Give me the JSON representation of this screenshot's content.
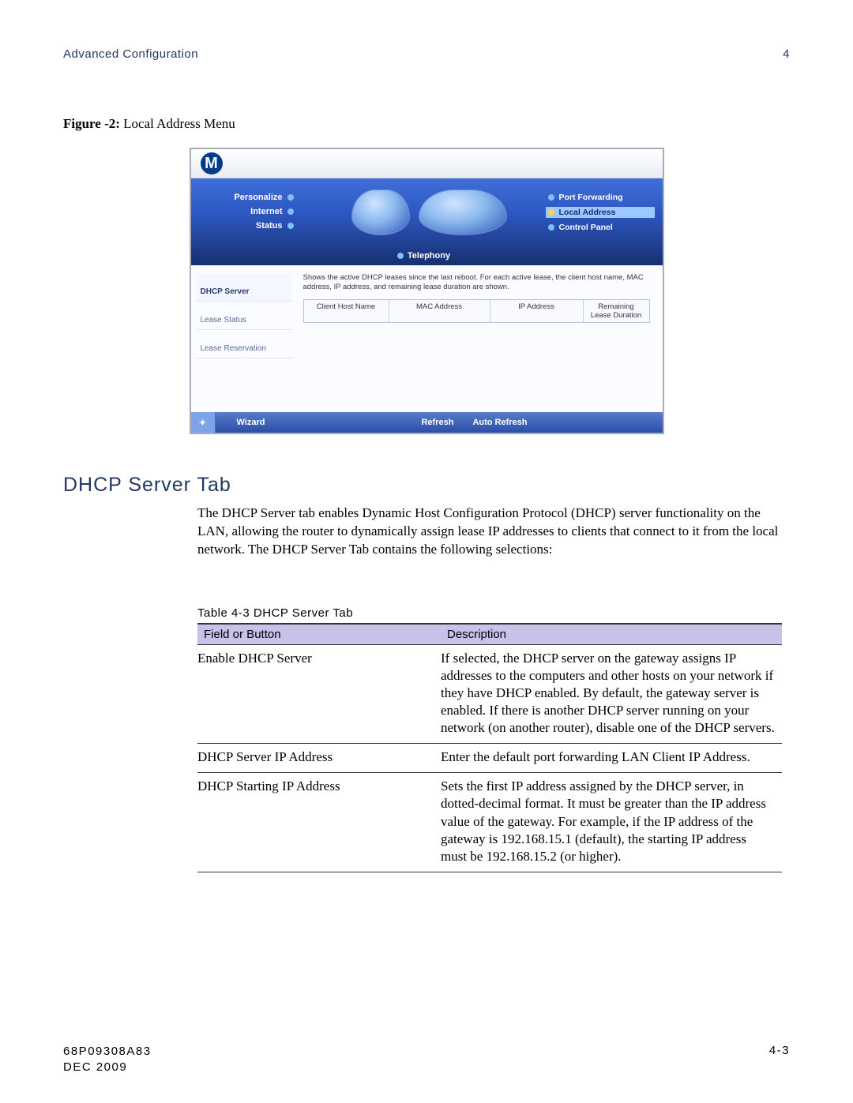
{
  "header": {
    "title": "Advanced Configuration",
    "chapter": "4"
  },
  "figure": {
    "label": "Figure -2:",
    "title": "Local Address Menu"
  },
  "screenshot": {
    "logo_letter": "M",
    "leftnav": [
      "Personalize",
      "Internet",
      "Status"
    ],
    "center_tab": "Telephony",
    "rightnav": [
      {
        "label": "Port Forwarding",
        "active": false
      },
      {
        "label": "Local Address",
        "active": true
      },
      {
        "label": "Control Panel",
        "active": false
      }
    ],
    "sidebar_tabs": [
      "DHCP Server",
      "Lease Status",
      "Lease Reservation"
    ],
    "description": "Shows the active DHCP leases since the last reboot. For each active lease, the client host name, MAC address, IP address, and remaining lease duration are shown.",
    "columns": [
      "Client Host Name",
      "MAC Address",
      "IP Address",
      "Remaining Lease Duration"
    ],
    "bottom": {
      "wizard": "Wizard",
      "refresh": "Refresh",
      "auto_refresh": "Auto Refresh"
    }
  },
  "section_title": "DHCP Server Tab",
  "section_body": "The DHCP Server tab enables Dynamic Host Configuration Protocol (DHCP) server functionality on the LAN, allowing the router to dynamically assign lease IP addresses to clients that connect to it from the local network. The DHCP Server Tab contains the following selections:",
  "table": {
    "caption": "Table 4-3 DHCP Server Tab",
    "head": {
      "field": "Field or Button",
      "desc": "Description"
    },
    "rows": [
      {
        "field": "Enable DHCP Server",
        "desc": "If selected, the DHCP server on the gateway assigns IP addresses to the computers and other hosts on your network if they have DHCP enabled. By default, the gateway server is enabled. If there is another DHCP server running on your network (on another router), disable one of the DHCP servers."
      },
      {
        "field": "DHCP Server IP Address",
        "desc": "Enter the default port forwarding LAN Client IP Address."
      },
      {
        "field": "DHCP Starting IP Address",
        "desc": "Sets the first IP address assigned by the DHCP server, in dotted-decimal format. It must be greater than the IP address value of the gateway. For example, if the IP address of the gateway is 192.168.15.1 (default), the starting IP address must be 192.168.15.2 (or higher)."
      }
    ]
  },
  "footer": {
    "docnum": "68P09308A83",
    "date": "DEC 2009",
    "page": "4-3"
  }
}
